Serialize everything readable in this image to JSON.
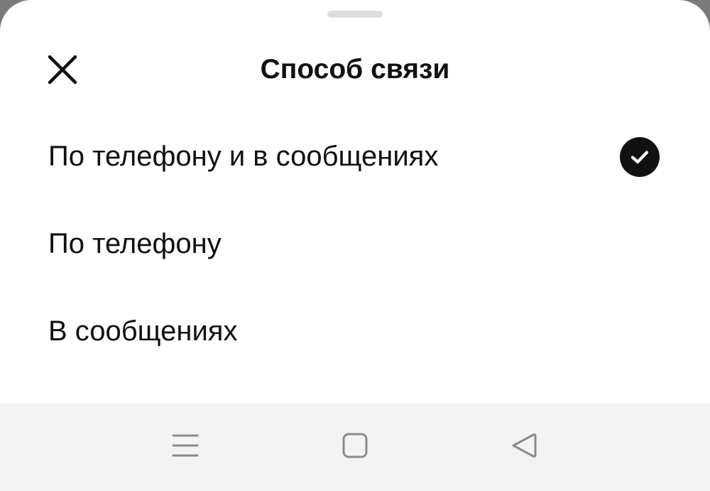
{
  "sheet": {
    "title": "Способ связи",
    "close_icon": "close-icon",
    "options": [
      {
        "label": "По телефону и в сообщениях",
        "selected": true
      },
      {
        "label": "По телефону",
        "selected": false
      },
      {
        "label": "В сообщениях",
        "selected": false
      }
    ],
    "selected_icon": "check-circle-icon"
  },
  "navbar": {
    "buttons": [
      "menu-icon",
      "home-square-icon",
      "back-triangle-icon"
    ],
    "icon_color": "#8a8a8a",
    "background": "#f3f3f3"
  },
  "colors": {
    "text": "#111111",
    "sheet_background": "#ffffff",
    "grabber": "#dedede"
  }
}
